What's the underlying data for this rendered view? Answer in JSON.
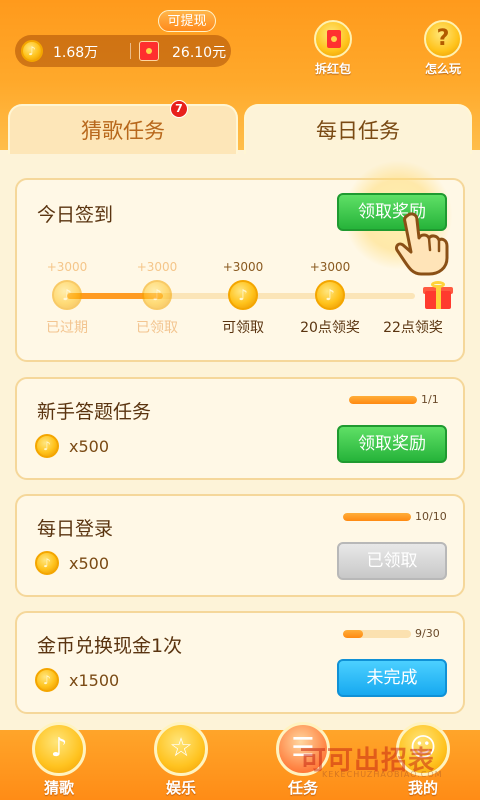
{
  "header": {
    "withdraw_tag": "可提现",
    "coins": "1.68万",
    "cash": "26.10元",
    "redpack_label": "拆红包",
    "help_label": "怎么玩"
  },
  "tabs": [
    {
      "label": "猜歌任务",
      "badge": "7"
    },
    {
      "label": "每日任务"
    }
  ],
  "checkin": {
    "title": "今日签到",
    "button": "领取奖励",
    "steps": [
      {
        "reward": "+3000",
        "status": "已过期"
      },
      {
        "reward": "+3000",
        "status": "已领取"
      },
      {
        "reward": "+3000",
        "status": "可领取"
      },
      {
        "reward": "+3000",
        "status": "20点领奖"
      },
      {
        "reward": "",
        "status": "22点领奖"
      }
    ]
  },
  "tasks": [
    {
      "title": "新手答题任务",
      "reward": "x500",
      "progress_text": "1/1",
      "progress": 1.0,
      "button": "领取奖励",
      "state": "claimable"
    },
    {
      "title": "每日登录",
      "reward": "x500",
      "progress_text": "10/10",
      "progress": 1.0,
      "button": "已领取",
      "state": "claimed"
    },
    {
      "title": "金币兑换现金1次",
      "reward": "x1500",
      "progress_text": "9/30",
      "progress": 0.3,
      "button": "未完成",
      "state": "incomplete"
    }
  ],
  "nav": [
    {
      "label": "猜歌",
      "icon": "music-note-icon"
    },
    {
      "label": "娱乐",
      "icon": "star-icon"
    },
    {
      "label": "任务",
      "icon": "task-icon"
    },
    {
      "label": "我的",
      "icon": "user-icon"
    }
  ],
  "watermark": {
    "text": "可可出招表",
    "sub": "KEKECHUZHAOBIAO.COM"
  },
  "colors": {
    "orange": "#ff9a1c",
    "green": "#26b33a",
    "blue": "#17a9f0",
    "gray": "#c8c8c8",
    "badge_red": "#e8201c"
  }
}
